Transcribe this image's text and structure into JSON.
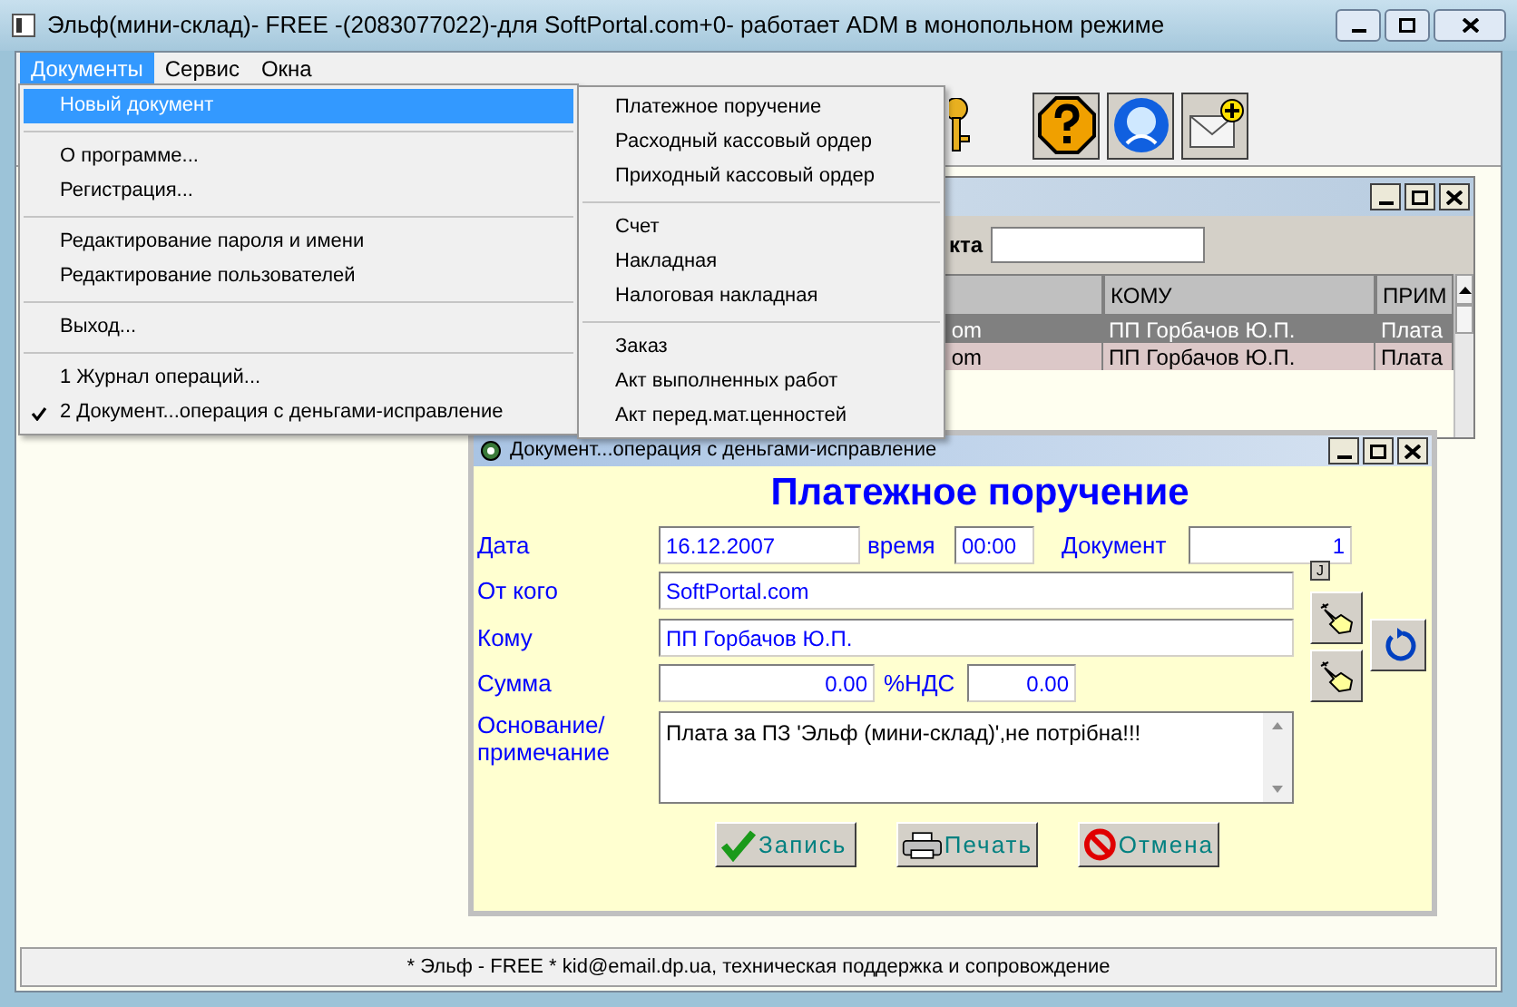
{
  "window": {
    "title": "Эльф(мини-склад)- FREE -(2083077022)-для SoftPortal.com+0- работает ADM в монопольном режиме"
  },
  "menu_bar": [
    {
      "label": "Документы",
      "selected": true
    },
    {
      "label": "Сервис",
      "selected": false
    },
    {
      "label": "Окна",
      "selected": false
    }
  ],
  "documents_menu": [
    {
      "kind": "item",
      "label": "Новый документ",
      "selected": true,
      "checked": false
    },
    {
      "kind": "separator"
    },
    {
      "kind": "item",
      "label": "О программе...",
      "selected": false,
      "checked": false
    },
    {
      "kind": "item",
      "label": "Регистрация...",
      "selected": false,
      "checked": false
    },
    {
      "kind": "separator"
    },
    {
      "kind": "item",
      "label": "Редактирование пароля и имени",
      "selected": false,
      "checked": false
    },
    {
      "kind": "item",
      "label": "Редактирование пользователей",
      "selected": false,
      "checked": false
    },
    {
      "kind": "separator"
    },
    {
      "kind": "item",
      "label": "Выход...",
      "selected": false,
      "checked": false
    },
    {
      "kind": "separator"
    },
    {
      "kind": "item",
      "label": "1 Журнал операций...",
      "selected": false,
      "checked": false
    },
    {
      "kind": "item",
      "label": "2 Документ...операция с деньгами-исправление",
      "selected": false,
      "checked": true
    }
  ],
  "new_document_submenu": [
    {
      "kind": "item",
      "label": "Платежное поручение"
    },
    {
      "kind": "item",
      "label": "Расходный кассовый ордер"
    },
    {
      "kind": "item",
      "label": "Приходный кассовый ордер"
    },
    {
      "kind": "separator"
    },
    {
      "kind": "item",
      "label": "Счет"
    },
    {
      "kind": "item",
      "label": "Накладная"
    },
    {
      "kind": "item",
      "label": "Налоговая накладная"
    },
    {
      "kind": "separator"
    },
    {
      "kind": "item",
      "label": "Заказ"
    },
    {
      "kind": "item",
      "label": "Акт выполненных работ"
    },
    {
      "kind": "item",
      "label": "Акт перед.мат.ценностей"
    }
  ],
  "journal_window": {
    "search_label": "кта",
    "table": {
      "columns": [
        "",
        "КОМУ",
        "ПРИМ"
      ],
      "rows": [
        {
          "cells": [
            "om",
            "ПП Горбачов Ю.П.",
            "Плата"
          ],
          "selected": true
        },
        {
          "cells": [
            "om",
            "ПП Горбачов Ю.П.",
            "Плата"
          ],
          "selected": false
        }
      ]
    }
  },
  "document_window": {
    "title": "Документ...операция с деньгами-исправление",
    "heading": "Платежное поручение",
    "date": {
      "label": "Дата",
      "value": "16.12.2007"
    },
    "time": {
      "label": "время",
      "value": "00:00"
    },
    "number": {
      "label": "Документ",
      "value": "1"
    },
    "small_button": "J",
    "from": {
      "label": "От кого",
      "value": "SoftPortal.com"
    },
    "to": {
      "label": "Кому",
      "value": "ПП Горбачов Ю.П."
    },
    "sum": {
      "label": "Сумма",
      "value": "0.00"
    },
    "vat": {
      "label": "%НДС",
      "value": "0.00"
    },
    "note": {
      "label": "Основание/ примечание",
      "value": "Плата за ПЗ 'Эльф (мини-склад)',не потрібна!!!"
    },
    "buttons": [
      {
        "kind": "save",
        "label": "Запись"
      },
      {
        "kind": "print",
        "label": "Печать"
      },
      {
        "kind": "cancel",
        "label": "Отмена"
      }
    ]
  },
  "status_bar": "* Эльф - FREE * kid@email.dp.ua, техническая поддержка и сопровождение"
}
